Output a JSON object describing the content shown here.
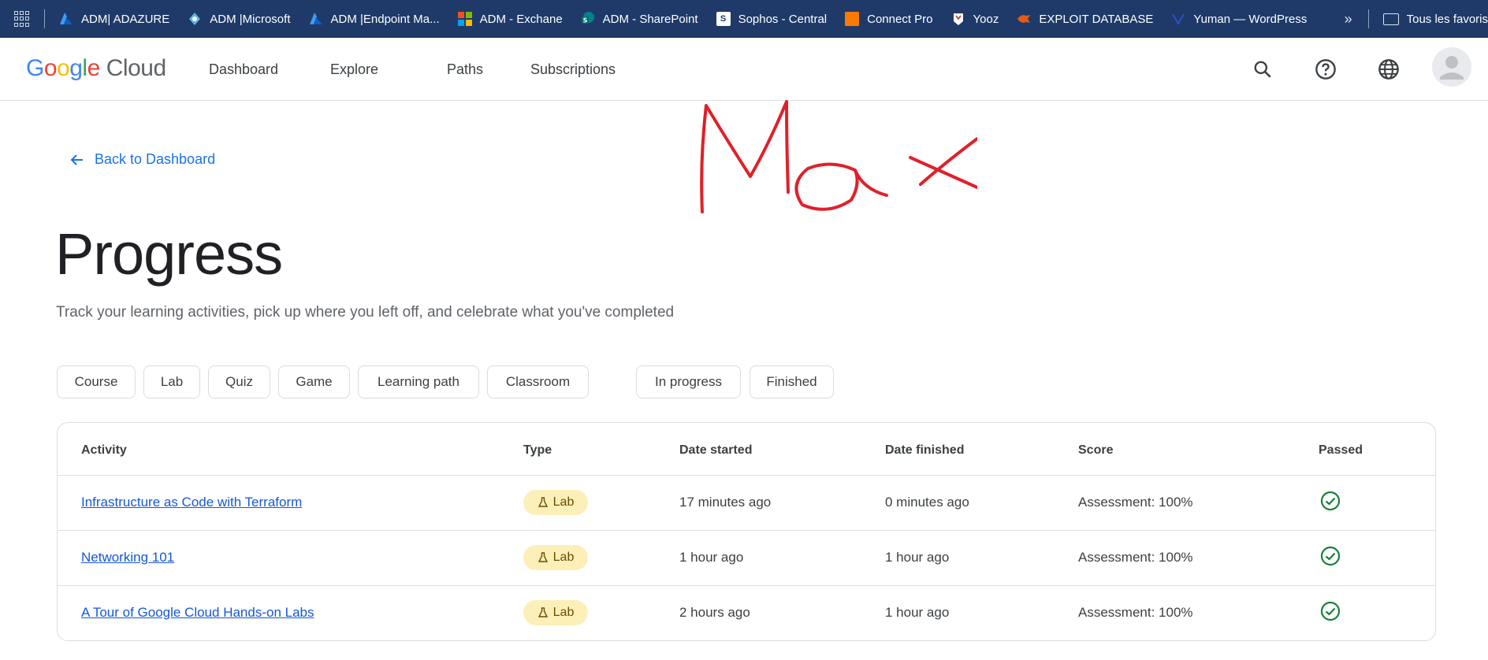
{
  "bookmarks": {
    "items": [
      {
        "label": "ADM| ADAZURE",
        "icon": "azure-icon",
        "color": "#0078d4"
      },
      {
        "label": "ADM |Microsoft",
        "icon": "azure-ad-icon",
        "color": "#3a96dd"
      },
      {
        "label": "ADM |Endpoint Ma...",
        "icon": "azure-icon",
        "color": "#0078d4"
      },
      {
        "label": "ADM - Exchane",
        "icon": "microsoft-icon",
        "color": "#f25022"
      },
      {
        "label": "ADM - SharePoint",
        "icon": "sharepoint-icon",
        "color": "#038387"
      },
      {
        "label": "Sophos - Central",
        "icon": "sophos-icon",
        "color": "#ffffff"
      },
      {
        "label": "Connect Pro",
        "icon": "orange-icon",
        "color": "#ff7900"
      },
      {
        "label": "Yooz",
        "icon": "yooz-icon",
        "color": "#ffffff"
      },
      {
        "label": "EXPLOIT DATABASE",
        "icon": "exploitdb-icon",
        "color": "#e35b16"
      },
      {
        "label": "Yuman — WordPress",
        "icon": "yuman-icon",
        "color": "#1e40af"
      }
    ],
    "folder_label": "Tous les favoris"
  },
  "header": {
    "logo_google": "Google",
    "logo_cloud": "Cloud",
    "nav": [
      "Dashboard",
      "Explore",
      "Paths",
      "Subscriptions"
    ]
  },
  "page": {
    "back_label": "Back to Dashboard",
    "title": "Progress",
    "subtitle": "Track your learning activities, pick up where you left off, and celebrate what you've completed",
    "type_filters": [
      "Course",
      "Lab",
      "Quiz",
      "Game",
      "Learning path",
      "Classroom"
    ],
    "status_filters": [
      "In progress",
      "Finished"
    ]
  },
  "table": {
    "columns": [
      "Activity",
      "Type",
      "Date started",
      "Date finished",
      "Score",
      "Passed"
    ],
    "rows": [
      {
        "activity": "Infrastructure as Code with Terraform",
        "type": "Lab",
        "started": "17 minutes ago",
        "finished": "0 minutes ago",
        "score": "Assessment: 100%",
        "passed": true
      },
      {
        "activity": "Networking 101",
        "type": "Lab",
        "started": "1 hour ago",
        "finished": "1 hour ago",
        "score": "Assessment: 100%",
        "passed": true
      },
      {
        "activity": "A Tour of Google Cloud Hands-on Labs",
        "type": "Lab",
        "started": "2 hours ago",
        "finished": "1 hour ago",
        "score": "Assessment: 100%",
        "passed": true
      }
    ]
  },
  "annotation": {
    "handwritten_text": "Max",
    "color": "#e0202a"
  },
  "colors": {
    "bookmarks_bar": "#1f3a68",
    "link": "#1a73e8",
    "lab_badge": "#fdefb8",
    "check": "#188038"
  }
}
